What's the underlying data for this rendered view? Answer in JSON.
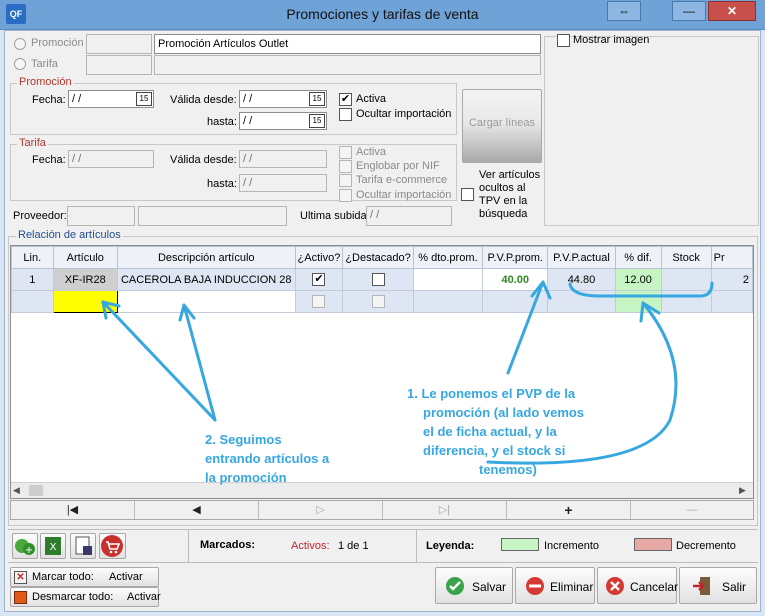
{
  "window": {
    "title": "Promociones y tarifas de venta",
    "app_icon_label": "QF",
    "restore_glyph": "⇔",
    "minimize_glyph": "—",
    "close_glyph": "✕"
  },
  "header": {
    "promocion_radio_label": "Promoción",
    "tarifa_radio_label": "Tarifa",
    "promocion_description": "Promoción Artículos Outlet",
    "mostrar_imagen_label": "Mostrar imagen"
  },
  "promocion_group": {
    "legend": "Promoción",
    "fecha_label": "Fecha:",
    "fecha_value": " / /",
    "valida_desde_label": "Válida desde:",
    "valida_desde_value": " / /",
    "hasta_label": "hasta:",
    "hasta_value": " / /",
    "activa_label": "Activa",
    "activa_checked": "✔",
    "ocultar_importacion_label": "Ocultar importación",
    "calendar_glyph": "15"
  },
  "tarifa_group": {
    "legend": "Tarifa",
    "fecha_label": "Fecha:",
    "fecha_value": " / /",
    "valida_desde_label": "Válida desde:",
    "valida_desde_value": " / /",
    "hasta_label": "hasta:",
    "hasta_value": " / /",
    "activa_label": "Activa",
    "englobar_label": "Englobar por NIF",
    "tarifa_ecommerce_label": "Tarifa e-commerce",
    "ocultar_importacion_label": "Ocultar importación",
    "proveedor_label": "Proveedor:",
    "ultima_subida_label": "Ultima subida",
    "ultima_subida_value": " / /"
  },
  "cargar_lineas_label": "Cargar líneas",
  "ver_articulos_label": "Ver artículos ocultos al TPV en la búsqueda",
  "relacion_label": "Relación de artículos",
  "table": {
    "columns": [
      "Lin.",
      "Artículo",
      "Descripción artículo",
      "¿Activo?",
      "¿Destacado?",
      "% dto.prom.",
      "P.V.P.prom.",
      "P.V.P.actual",
      "% dif.",
      "Stock",
      "Pr"
    ],
    "rows": [
      {
        "lin": "1",
        "articulo": "XF-IR28",
        "descripcion": "CACEROLA BAJA INDUCCION 28",
        "activo": "✔",
        "destacado": "",
        "dto": "",
        "pvp_prom": "40.00",
        "pvp_actual": "44.80",
        "dif": "12.00",
        "stock": "",
        "pr": "2"
      },
      {
        "lin": "",
        "articulo": "",
        "descripcion": "",
        "activo": "",
        "destacado": "",
        "dto": "",
        "pvp_prom": "",
        "pvp_actual": "",
        "dif": "",
        "stock": "",
        "pr": ""
      }
    ]
  },
  "navigation": {
    "first": "|◀",
    "prev": "◀",
    "next": "▷",
    "last": "▷|",
    "add": "+",
    "remove": "—"
  },
  "status": {
    "marcados_label": "Marcados:",
    "activos_label": "Activos:",
    "activos_value": "1 de 1",
    "leyenda_label": "Leyenda:",
    "incremento_label": "Incremento",
    "decremento_label": "Decremento",
    "incremento_color": "#c6f5c3",
    "decremento_color": "#e6a9a5"
  },
  "footer": {
    "marcar_todo_label": "Marcar todo:",
    "marcar_todo_action": "Activar",
    "desmarcar_todo_label": "Desmarcar todo:",
    "desmarcar_todo_action": "Activar",
    "salvar_label": "Salvar",
    "eliminar_label": "Eliminar",
    "cancelar_label": "Cancelar",
    "salir_label": "Salir"
  },
  "annotations": {
    "note1_lines": [
      "1. Le ponemos el PVP de la",
      "promoción (al lado vemos",
      "el de ficha actual, y la",
      "diferencia, y el stock si",
      "tenemos)"
    ],
    "note2_lines": [
      "2. Seguimos",
      "entrando artículos a",
      "la promoción"
    ]
  }
}
